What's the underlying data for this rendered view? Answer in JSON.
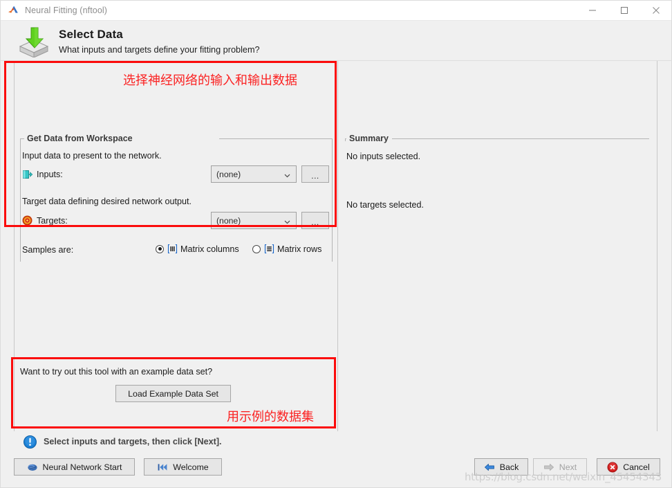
{
  "window": {
    "title": "Neural Fitting (nftool)",
    "app_icon": "matlab-icon",
    "controls": {
      "minimize": "minimize-icon",
      "maximize": "maximize-icon",
      "close": "close-icon"
    }
  },
  "header": {
    "icon": "import-data-icon",
    "title": "Select Data",
    "subtitle": "What inputs and targets define your fitting problem?"
  },
  "workspace_panel": {
    "legend": "Get Data from Workspace",
    "input_description": "Input data to present to the network.",
    "inputs_label": "Inputs:",
    "inputs_icon": "input-port-icon",
    "inputs_value": "(none)",
    "inputs_browse": "...",
    "target_description": "Target data defining desired network output.",
    "targets_label": "Targets:",
    "targets_icon": "target-bullseye-icon",
    "targets_value": "(none)",
    "targets_browse": "...",
    "samples_label": "Samples are:",
    "samples_options": [
      {
        "label": "Matrix columns",
        "icon": "matrix-columns-icon",
        "selected": true
      },
      {
        "label": "Matrix rows",
        "icon": "matrix-rows-icon",
        "selected": false
      }
    ]
  },
  "summary_panel": {
    "legend": "Summary",
    "no_inputs": "No inputs selected.",
    "no_targets": "No targets selected."
  },
  "example_panel": {
    "question": "Want to try out this tool with an example data set?",
    "load_button": "Load Example Data Set"
  },
  "annotations": [
    {
      "text": "选择神经网络的输入和输出数据",
      "name": "annotation-select-io-data"
    },
    {
      "text": "用示例的数据集",
      "name": "annotation-use-example-dataset"
    }
  ],
  "status": {
    "icon": "info-exclamation-icon",
    "message": "Select inputs and targets, then click [Next]."
  },
  "buttons": {
    "neural_network_start": {
      "label": "Neural Network Start",
      "icon": "brain-icon"
    },
    "welcome": {
      "label": "Welcome",
      "icon": "skip-to-start-icon"
    },
    "back": {
      "label": "Back",
      "icon": "arrow-left-icon",
      "enabled": true
    },
    "next": {
      "label": "Next",
      "icon": "arrow-right-icon",
      "enabled": false
    },
    "cancel": {
      "label": "Cancel",
      "icon": "cancel-x-icon",
      "enabled": true
    }
  },
  "watermark": "https://blog.csdn.net/weixin_45454343",
  "colors": {
    "accent_red": "#fb0b0b",
    "panel_bg": "#f0f0f0",
    "button_bg": "#e6e6e6",
    "info_blue": "#1a7fd4",
    "cancel_red": "#d42020"
  }
}
